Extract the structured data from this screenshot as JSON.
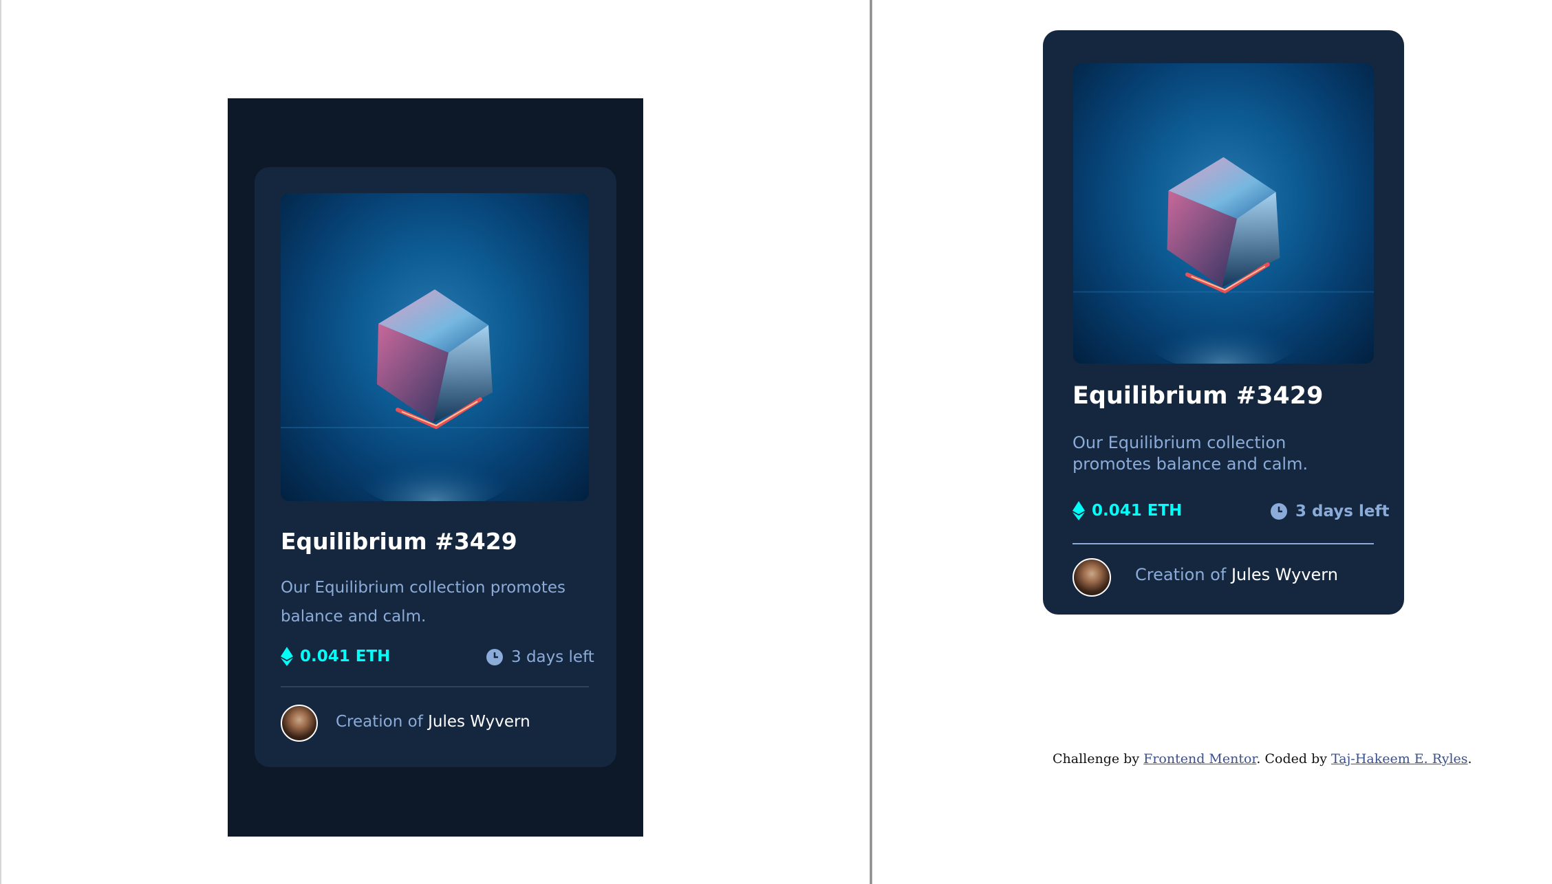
{
  "colors": {
    "page_bg": "#ffffff",
    "preview_bg": "#0d1829",
    "card_bg": "#15263f",
    "cyan": "#00fff8",
    "soft_blue": "#8bacd9",
    "white": "#ffffff"
  },
  "preview_card": {
    "image_alt": "equilibrium-cube-image",
    "title": "Equilibrium #3429",
    "description": "Our Equilibrium collection promotes balance and calm.",
    "price": "0.041 ETH",
    "price_icon": "ethereum-icon",
    "time_left": "3 days left",
    "time_icon": "clock-icon",
    "creator_prefix": "Creation of",
    "creator_name": "Jules Wyvern"
  },
  "built_card": {
    "image_alt": "equilibrium-cube-image",
    "title": "Equilibrium #3429",
    "description": "Our Equilibrium collection promotes balance and calm.",
    "price": "0.041 ETH",
    "price_icon": "ethereum-icon",
    "time_left": "3 days left",
    "time_icon": "clock-icon",
    "creator_prefix": "Creation of",
    "creator_name": "Jules Wyvern"
  },
  "attribution": {
    "prefix": "Challenge by",
    "link1": "Frontend Mentor",
    "middle": ". Coded by",
    "link2": "Taj-Hakeem E. Ryles",
    "suffix": "."
  }
}
